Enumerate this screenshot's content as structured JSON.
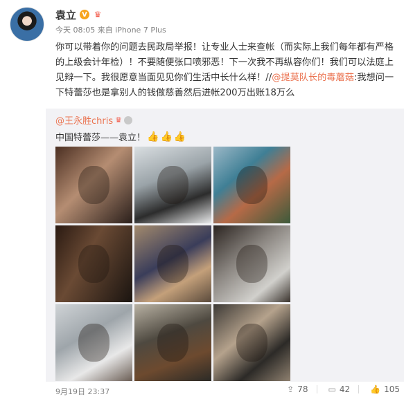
{
  "post": {
    "author": "袁立",
    "time": "今天 08:05",
    "source": "来自 iPhone 7 Plus",
    "text_main": "你可以带着你的问题去民政局举报！让专业人士来查帐（而实际上我们每年都有严格的上级会计年检）！不要随便张口喷邪恶！下一次我不再纵容你们！我们可以法庭上见辩一下。我很愿意当面见见你们生活中长什么样！//",
    "mention": "@提莫队长的毒蘑菇",
    "text_after": ":我想问一下特蕾莎也是拿别人的钱做慈善然后进帐200万出账18万么"
  },
  "repost": {
    "author": "@王永胜chris",
    "text": "中国特蕾莎——袁立！",
    "photo_count": 9
  },
  "footer": {
    "date": "9月19日 23:37",
    "share_count": "78",
    "comment_count": "42",
    "like_count": "105"
  },
  "icons": {
    "verified": "verified-v-badge",
    "vip": "vip-crown-icon",
    "share": "share-icon",
    "comment": "comment-icon",
    "like": "like-icon",
    "thumb": "thumbs-up-icon"
  },
  "colors": {
    "mention": "#eb7350",
    "repost_bg": "#f2f2f5",
    "meta": "#808080"
  }
}
